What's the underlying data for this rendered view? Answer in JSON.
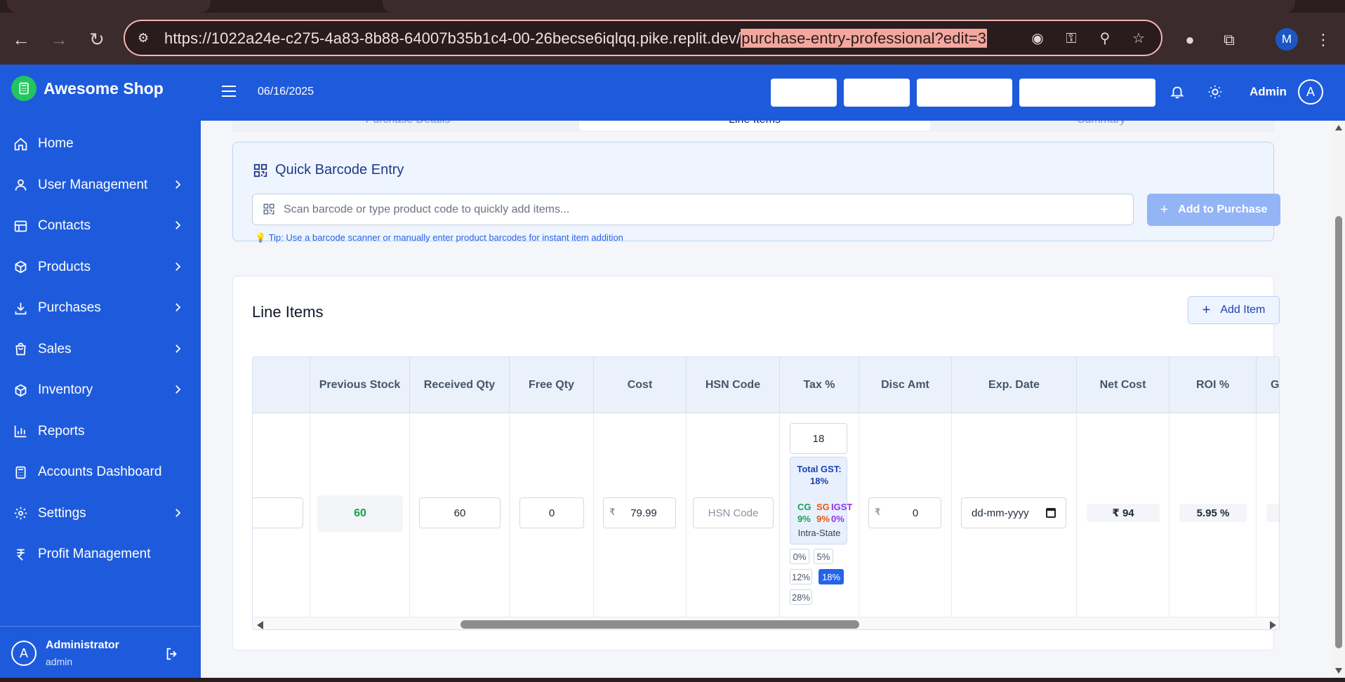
{
  "browser": {
    "url_base": "https://1022a24e-c275-4a83-8b88-64007b35b1c4-00-26becse6iqlqq.pike.replit.dev/",
    "url_highlight": "purchase-entry-professional?edit=3",
    "profile_initial": "M"
  },
  "sidebar": {
    "brand": "Awesome Shop",
    "items": [
      {
        "label": "Home",
        "icon": "home-icon",
        "has_chevron": false
      },
      {
        "label": "User Management",
        "icon": "user-icon",
        "has_chevron": true
      },
      {
        "label": "Contacts",
        "icon": "table-icon",
        "has_chevron": true
      },
      {
        "label": "Products",
        "icon": "box-icon",
        "has_chevron": true
      },
      {
        "label": "Purchases",
        "icon": "download-icon",
        "has_chevron": true
      },
      {
        "label": "Sales",
        "icon": "shopping-bag-icon",
        "has_chevron": true
      },
      {
        "label": "Inventory",
        "icon": "box-icon",
        "has_chevron": true
      },
      {
        "label": "Reports",
        "icon": "bar-chart-icon",
        "has_chevron": false
      },
      {
        "label": "Accounts Dashboard",
        "icon": "calculator-icon",
        "has_chevron": false
      },
      {
        "label": "Settings",
        "icon": "gear-icon",
        "has_chevron": true
      },
      {
        "label": "Profit Management",
        "icon": "rupee-icon",
        "has_chevron": false
      }
    ],
    "footer": {
      "initial": "A",
      "name": "Administrator",
      "role": "admin"
    }
  },
  "header": {
    "date": "06/16/2025",
    "user": "Admin",
    "user_initial": "A"
  },
  "tabs": [
    {
      "label": "Purchase Details",
      "active": false
    },
    {
      "label": "Line Items",
      "active": true
    },
    {
      "label": "Summary",
      "active": false
    }
  ],
  "barcode": {
    "title": "Quick Barcode Entry",
    "placeholder": "Scan barcode or type product code to quickly add items...",
    "button": "Add to Purchase",
    "tip": "💡 Tip: Use a barcode scanner or manually enter product barcodes for instant item addition"
  },
  "line_items": {
    "title": "Line Items",
    "add_button": "Add Item",
    "columns": [
      "Previous Stock",
      "Received Qty",
      "Free Qty",
      "Cost",
      "HSN Code",
      "Tax %",
      "Disc Amt",
      "Exp. Date",
      "Net Cost",
      "ROI %",
      "Gr"
    ],
    "row": {
      "previous_stock": "60",
      "received_qty": "60",
      "free_qty": "0",
      "currency": "₹",
      "cost": "79.99",
      "hsn_placeholder": "HSN Code",
      "tax": "18",
      "gst_total": "Total GST: 18%",
      "cgst_label": "CG",
      "cgst_value": "9%",
      "sgst_label": "SG",
      "sgst_value": "9%",
      "igst_label": "IGST",
      "igst_value": "0%",
      "tax_state": "Intra-State",
      "tax_rates": [
        "0%",
        "5%",
        "12%",
        "18%",
        "28%"
      ],
      "tax_rate_selected": "18%",
      "disc_amt": "0",
      "exp_placeholder": "dd-mm-yyyy",
      "net_cost": "₹ 94",
      "roi": "5.95 %"
    }
  },
  "colors": {
    "primary": "#1e5bdc",
    "stock_green": "#16a34a",
    "cgst_green": "#16a34a",
    "sgst_orange": "#ea580c",
    "igst_purple": "#9333ea"
  }
}
